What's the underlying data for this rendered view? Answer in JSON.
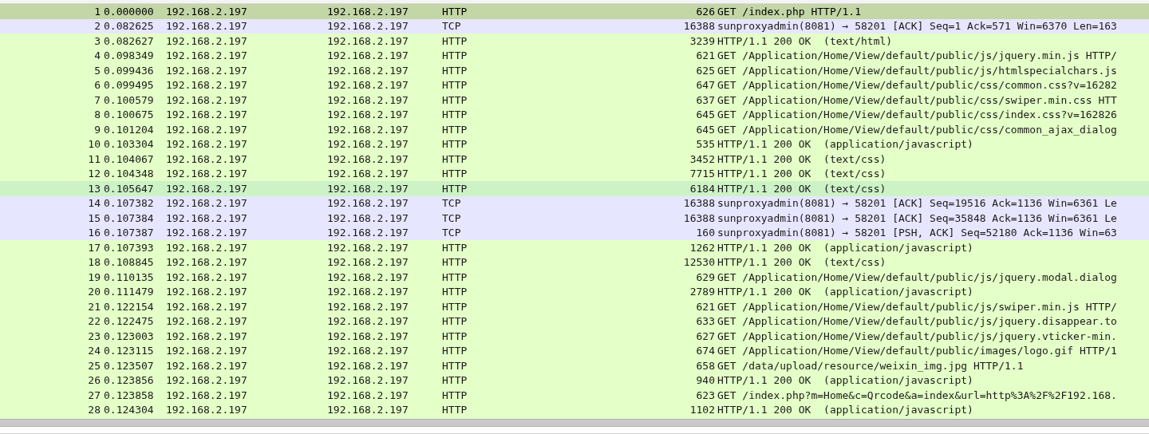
{
  "packets": [
    {
      "no": "1",
      "time": "0.000000",
      "source": "192.168.2.197",
      "destination": "192.168.2.197",
      "protocol": "HTTP",
      "length": "626",
      "info": "GET /index.php HTTP/1.1",
      "color": "#c3d6a6",
      "selected": true
    },
    {
      "no": "2",
      "time": "0.082625",
      "source": "192.168.2.197",
      "destination": "192.168.2.197",
      "protocol": "TCP",
      "length": "16388",
      "info": "sunproxyadmin(8081) → 58201 [ACK] Seq=1 Ack=571 Win=6370 Len=163",
      "color": "#e7e6ff",
      "selected": false
    },
    {
      "no": "3",
      "time": "0.082627",
      "source": "192.168.2.197",
      "destination": "192.168.2.197",
      "protocol": "HTTP",
      "length": "3239",
      "info": "HTTP/1.1 200 OK  (text/html)",
      "color": "#e4ffc7",
      "selected": false
    },
    {
      "no": "4",
      "time": "0.098349",
      "source": "192.168.2.197",
      "destination": "192.168.2.197",
      "protocol": "HTTP",
      "length": "621",
      "info": "GET /Application/Home/View/default/public/js/jquery.min.js HTTP/",
      "color": "#e4ffc7",
      "selected": false
    },
    {
      "no": "5",
      "time": "0.099436",
      "source": "192.168.2.197",
      "destination": "192.168.2.197",
      "protocol": "HTTP",
      "length": "625",
      "info": "GET /Application/Home/View/default/public/js/htmlspecialchars.js",
      "color": "#e4ffc7",
      "selected": false
    },
    {
      "no": "6",
      "time": "0.099495",
      "source": "192.168.2.197",
      "destination": "192.168.2.197",
      "protocol": "HTTP",
      "length": "647",
      "info": "GET /Application/Home/View/default/public/css/common.css?v=16282",
      "color": "#e4ffc7",
      "selected": false
    },
    {
      "no": "7",
      "time": "0.100579",
      "source": "192.168.2.197",
      "destination": "192.168.2.197",
      "protocol": "HTTP",
      "length": "637",
      "info": "GET /Application/Home/View/default/public/css/swiper.min.css HTT",
      "color": "#e4ffc7",
      "selected": false
    },
    {
      "no": "8",
      "time": "0.100675",
      "source": "192.168.2.197",
      "destination": "192.168.2.197",
      "protocol": "HTTP",
      "length": "645",
      "info": "GET /Application/Home/View/default/public/css/index.css?v=162826",
      "color": "#e4ffc7",
      "selected": false
    },
    {
      "no": "9",
      "time": "0.101204",
      "source": "192.168.2.197",
      "destination": "192.168.2.197",
      "protocol": "HTTP",
      "length": "645",
      "info": "GET /Application/Home/View/default/public/css/common_ajax_dialog",
      "color": "#e4ffc7",
      "selected": false
    },
    {
      "no": "10",
      "time": "0.103304",
      "source": "192.168.2.197",
      "destination": "192.168.2.197",
      "protocol": "HTTP",
      "length": "535",
      "info": "HTTP/1.1 200 OK  (application/javascript)",
      "color": "#e4ffc7",
      "selected": false
    },
    {
      "no": "11",
      "time": "0.104067",
      "source": "192.168.2.197",
      "destination": "192.168.2.197",
      "protocol": "HTTP",
      "length": "3452",
      "info": "HTTP/1.1 200 OK  (text/css)",
      "color": "#e4ffc7",
      "selected": false
    },
    {
      "no": "12",
      "time": "0.104348",
      "source": "192.168.2.197",
      "destination": "192.168.2.197",
      "protocol": "HTTP",
      "length": "7715",
      "info": "HTTP/1.1 200 OK  (text/css)",
      "color": "#e4ffc7",
      "selected": false
    },
    {
      "no": "13",
      "time": "0.105647",
      "source": "192.168.2.197",
      "destination": "192.168.2.197",
      "protocol": "HTTP",
      "length": "6184",
      "info": "HTTP/1.1 200 OK  (text/css)",
      "color": "#ccf2c6",
      "selected": false
    },
    {
      "no": "14",
      "time": "0.107382",
      "source": "192.168.2.197",
      "destination": "192.168.2.197",
      "protocol": "TCP",
      "length": "16388",
      "info": "sunproxyadmin(8081) → 58201 [ACK] Seq=19516 Ack=1136 Win=6361 Le",
      "color": "#e7e6ff",
      "selected": false
    },
    {
      "no": "15",
      "time": "0.107384",
      "source": "192.168.2.197",
      "destination": "192.168.2.197",
      "protocol": "TCP",
      "length": "16388",
      "info": "sunproxyadmin(8081) → 58201 [ACK] Seq=35848 Ack=1136 Win=6361 Le",
      "color": "#e7e6ff",
      "selected": false
    },
    {
      "no": "16",
      "time": "0.107387",
      "source": "192.168.2.197",
      "destination": "192.168.2.197",
      "protocol": "TCP",
      "length": "160",
      "info": "sunproxyadmin(8081) → 58201 [PSH, ACK] Seq=52180 Ack=1136 Win=63",
      "color": "#e7e6ff",
      "selected": false
    },
    {
      "no": "17",
      "time": "0.107393",
      "source": "192.168.2.197",
      "destination": "192.168.2.197",
      "protocol": "HTTP",
      "length": "1262",
      "info": "HTTP/1.1 200 OK  (application/javascript)",
      "color": "#e4ffc7",
      "selected": false
    },
    {
      "no": "18",
      "time": "0.108845",
      "source": "192.168.2.197",
      "destination": "192.168.2.197",
      "protocol": "HTTP",
      "length": "12530",
      "info": "HTTP/1.1 200 OK  (text/css)",
      "color": "#e4ffc7",
      "selected": false
    },
    {
      "no": "19",
      "time": "0.110135",
      "source": "192.168.2.197",
      "destination": "192.168.2.197",
      "protocol": "HTTP",
      "length": "629",
      "info": "GET /Application/Home/View/default/public/js/jquery.modal.dialog",
      "color": "#e4ffc7",
      "selected": false
    },
    {
      "no": "20",
      "time": "0.111479",
      "source": "192.168.2.197",
      "destination": "192.168.2.197",
      "protocol": "HTTP",
      "length": "2789",
      "info": "HTTP/1.1 200 OK  (application/javascript)",
      "color": "#e4ffc7",
      "selected": false
    },
    {
      "no": "21",
      "time": "0.122154",
      "source": "192.168.2.197",
      "destination": "192.168.2.197",
      "protocol": "HTTP",
      "length": "621",
      "info": "GET /Application/Home/View/default/public/js/swiper.min.js HTTP/",
      "color": "#e4ffc7",
      "selected": false
    },
    {
      "no": "22",
      "time": "0.122475",
      "source": "192.168.2.197",
      "destination": "192.168.2.197",
      "protocol": "HTTP",
      "length": "633",
      "info": "GET /Application/Home/View/default/public/js/jquery.disappear.to",
      "color": "#e4ffc7",
      "selected": false
    },
    {
      "no": "23",
      "time": "0.123003",
      "source": "192.168.2.197",
      "destination": "192.168.2.197",
      "protocol": "HTTP",
      "length": "627",
      "info": "GET /Application/Home/View/default/public/js/jquery.vticker-min.",
      "color": "#e4ffc7",
      "selected": false
    },
    {
      "no": "24",
      "time": "0.123115",
      "source": "192.168.2.197",
      "destination": "192.168.2.197",
      "protocol": "HTTP",
      "length": "674",
      "info": "GET /Application/Home/View/default/public/images/logo.gif HTTP/1",
      "color": "#e4ffc7",
      "selected": false
    },
    {
      "no": "25",
      "time": "0.123507",
      "source": "192.168.2.197",
      "destination": "192.168.2.197",
      "protocol": "HTTP",
      "length": "658",
      "info": "GET /data/upload/resource/weixin_img.jpg HTTP/1.1",
      "color": "#e4ffc7",
      "selected": false
    },
    {
      "no": "26",
      "time": "0.123856",
      "source": "192.168.2.197",
      "destination": "192.168.2.197",
      "protocol": "HTTP",
      "length": "940",
      "info": "HTTP/1.1 200 OK  (application/javascript)",
      "color": "#e4ffc7",
      "selected": false
    },
    {
      "no": "27",
      "time": "0.123858",
      "source": "192.168.2.197",
      "destination": "192.168.2.197",
      "protocol": "HTTP",
      "length": "623",
      "info": "GET /index.php?m=Home&c=Qrcode&a=index&url=http%3A%2F%2F192.168.",
      "color": "#e4ffc7",
      "selected": false
    },
    {
      "no": "28",
      "time": "0.124304",
      "source": "192.168.2.197",
      "destination": "192.168.2.197",
      "protocol": "HTTP",
      "length": "1102",
      "info": "HTTP/1.1 200 OK  (application/javascript)",
      "color": "#e4ffc7",
      "selected": false
    }
  ]
}
